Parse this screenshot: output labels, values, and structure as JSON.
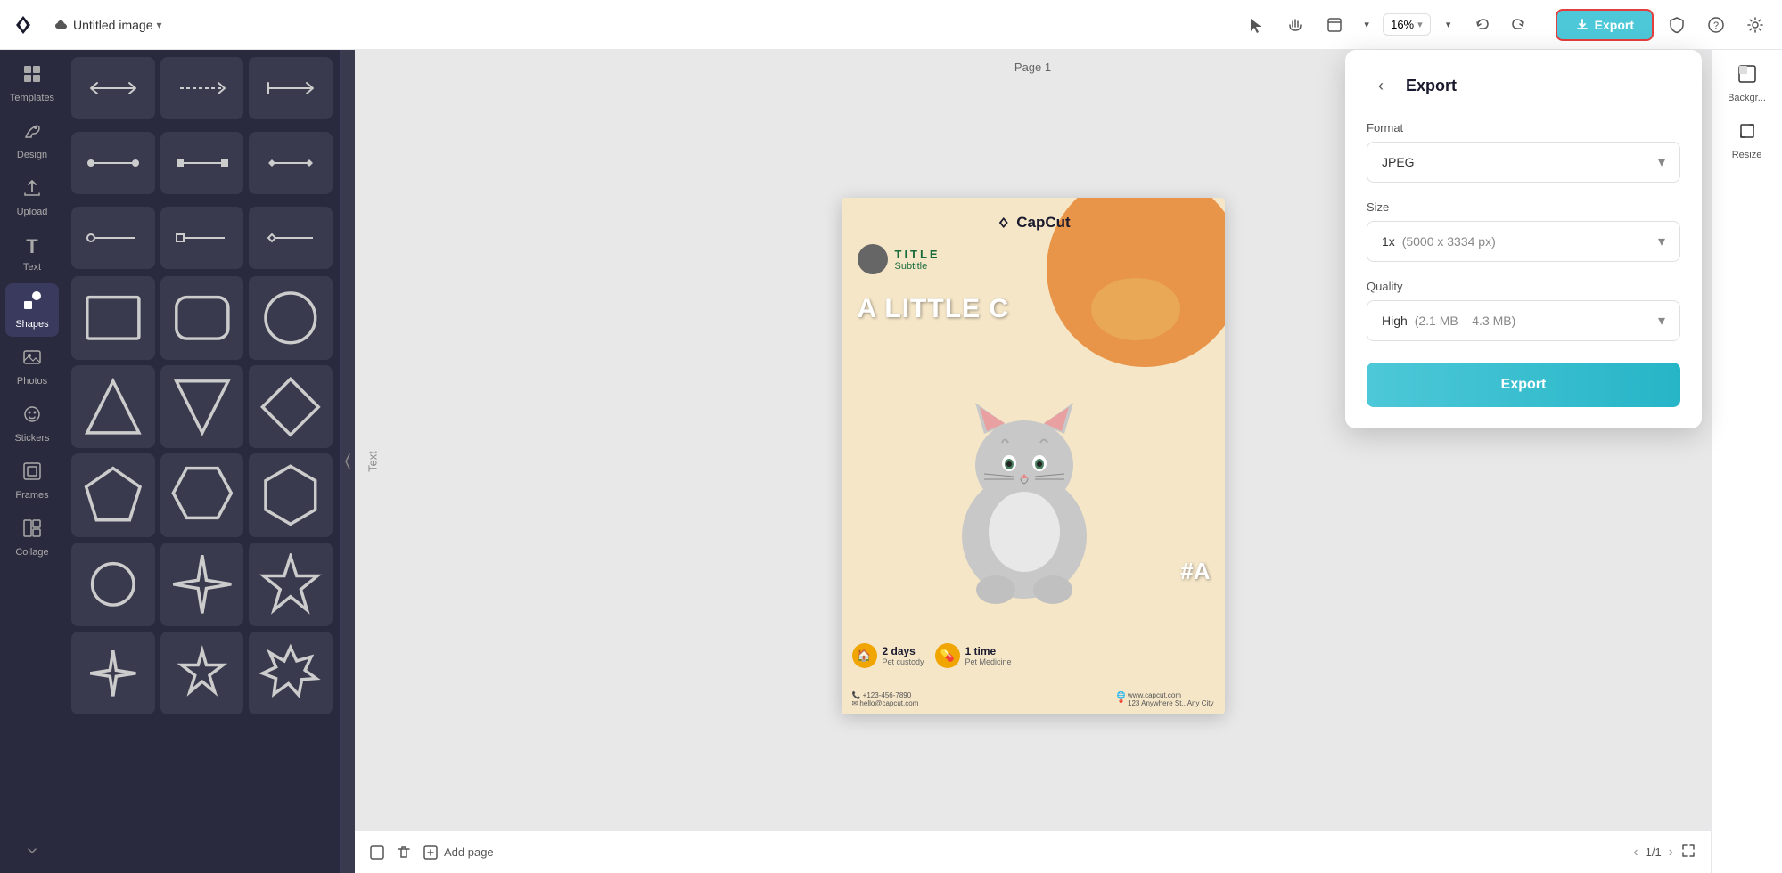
{
  "app": {
    "logo": "✕",
    "logo_text": "CapCut"
  },
  "topbar": {
    "doc_title": "Untitled image",
    "doc_chevron": "▾",
    "zoom_level": "16%",
    "export_label": "Export",
    "export_icon": "↑"
  },
  "left_sidebar": {
    "items": [
      {
        "id": "templates",
        "icon": "⊞",
        "label": "Templates"
      },
      {
        "id": "design",
        "icon": "✏",
        "label": "Design"
      },
      {
        "id": "upload",
        "icon": "↑",
        "label": "Upload"
      },
      {
        "id": "text",
        "icon": "T",
        "label": "Text"
      },
      {
        "id": "shapes",
        "icon": "◆",
        "label": "Shapes"
      },
      {
        "id": "photos",
        "icon": "🖼",
        "label": "Photos"
      },
      {
        "id": "stickers",
        "icon": "☺",
        "label": "Stickers"
      },
      {
        "id": "frames",
        "icon": "⬜",
        "label": "Frames"
      },
      {
        "id": "collage",
        "icon": "▦",
        "label": "Collage"
      }
    ],
    "active": "shapes"
  },
  "shapes_panel": {
    "arrow_rows": [
      {
        "arrows": [
          "↔",
          "⇢",
          "↦"
        ]
      }
    ],
    "shapes": [
      {
        "type": "line-circle-circle",
        "label": "line with circles"
      },
      {
        "type": "line-square-square",
        "label": "line with squares"
      },
      {
        "type": "line-diamond-diamond",
        "label": "line with diamonds"
      },
      {
        "type": "line-circle-h",
        "label": "line circle h"
      },
      {
        "type": "line-square-h",
        "label": "line square h"
      },
      {
        "type": "line-diamond-h",
        "label": "line diamond h"
      },
      {
        "type": "rect-empty",
        "label": "rectangle empty"
      },
      {
        "type": "rect-rounded",
        "label": "rounded rectangle"
      },
      {
        "type": "circle",
        "label": "circle"
      },
      {
        "type": "triangle-up",
        "label": "triangle up"
      },
      {
        "type": "triangle-down",
        "label": "triangle down"
      },
      {
        "type": "diamond",
        "label": "diamond"
      },
      {
        "type": "pentagon",
        "label": "pentagon"
      },
      {
        "type": "hexagon-h",
        "label": "hexagon horizontal"
      },
      {
        "type": "hexagon-v",
        "label": "hexagon vertical"
      },
      {
        "type": "circle-small",
        "label": "circle small"
      },
      {
        "type": "star-4",
        "label": "4-point star"
      },
      {
        "type": "star-5",
        "label": "5-point star"
      },
      {
        "type": "star-4-outline",
        "label": "4-point star outline"
      },
      {
        "type": "star-5-outline",
        "label": "5-point star outline"
      },
      {
        "type": "star-6-outline",
        "label": "6-point star outline"
      }
    ]
  },
  "canvas": {
    "page_label": "Page 1",
    "add_page_label": "Add page",
    "page_current": "1",
    "page_total": "1"
  },
  "canvas_content": {
    "logo": "✕ CapCut",
    "title": "TITLE",
    "subtitle": "Subtitle",
    "headline": "A LITTLE C",
    "hashtag": "#A",
    "stats": [
      {
        "num": "2 days",
        "label": "Pet custody"
      },
      {
        "num": "1 time",
        "label": "Pet Medicine"
      }
    ],
    "footer_left": "+123-456-7890\nhello@capcut.com",
    "footer_right": "www.capcut.com\n123 Anywhere St., Any City"
  },
  "export_panel": {
    "title": "Export",
    "back_label": "‹",
    "format_label": "Format",
    "format_value": "JPEG",
    "size_label": "Size",
    "size_value": "1x",
    "size_detail": "(5000 x 3334 px)",
    "quality_label": "Quality",
    "quality_value": "High",
    "quality_detail": "(2.1 MB – 4.3 MB)",
    "export_btn": "Export"
  },
  "right_sidebar": {
    "items": [
      {
        "id": "background",
        "icon": "⬜",
        "label": "Backgr..."
      },
      {
        "id": "resize",
        "icon": "⬚",
        "label": "Resize"
      }
    ]
  },
  "colors": {
    "export_btn_bg": "#4dc8d8",
    "export_btn_border": "#e53e3e",
    "active_sidebar_bg": "#3a3a5e",
    "canvas_bg": "#f5e6c8"
  }
}
